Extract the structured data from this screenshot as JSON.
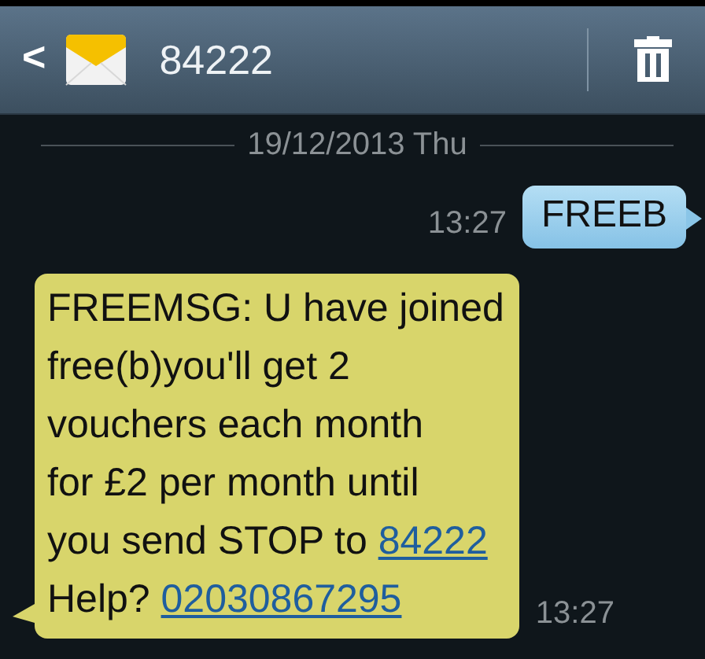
{
  "header": {
    "back": "<",
    "title": "84222"
  },
  "date_divider": "19/12/2013 Thu",
  "messages": [
    {
      "kind": "sent",
      "time": "13:27",
      "segments": [
        {
          "kind": "text",
          "text": "FREEB"
        }
      ]
    },
    {
      "kind": "received",
      "time": "13:27",
      "segments": [
        {
          "kind": "text",
          "text": "FREEMSG: U have joined\nfree(b)you'll get 2\nvouchers each month\nfor £2 per month until\nyou send STOP to "
        },
        {
          "kind": "link",
          "text": "84222"
        },
        {
          "kind": "text",
          "text": "\nHelp? "
        },
        {
          "kind": "link",
          "text": "02030867295"
        }
      ]
    }
  ]
}
